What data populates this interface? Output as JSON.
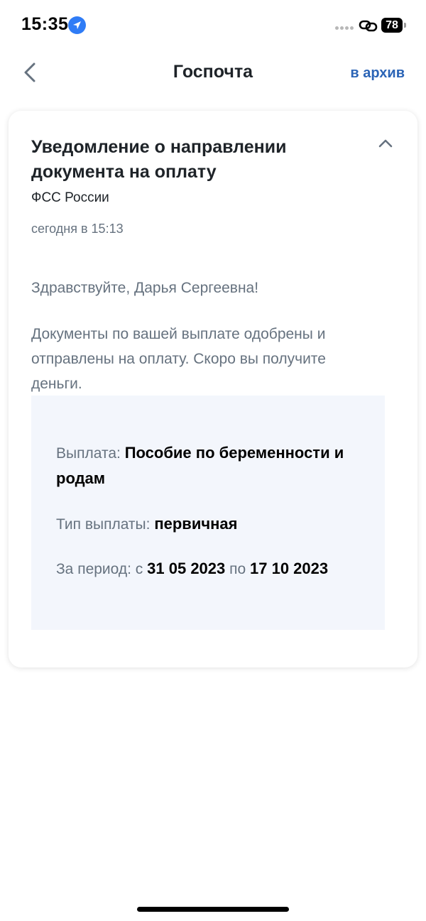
{
  "status_bar": {
    "time": "15:35",
    "battery": "78"
  },
  "header": {
    "title": "Госпочта",
    "archive_label": "в архив"
  },
  "message": {
    "title": "Уведомление о направлении документа на оплату",
    "sender": "ФСС России",
    "date": "сегодня в 15:13",
    "greeting": "Здравствуйте, Дарья Сергеевна!",
    "body": "Документы по вашей выплате одобрены и отправлены на оплату. Скоро вы получите деньги."
  },
  "details": {
    "payment_label": "Выплата:",
    "payment_value": "Пособие по беременности и родам",
    "type_label": "Тип выплаты:",
    "type_value": "первичная",
    "period_label": "За период: с",
    "period_from": "31 05 2023",
    "period_mid": "по",
    "period_to": "17 10 2023"
  },
  "colors": {
    "accent": "#2b64b6",
    "location": "#2f7cf6",
    "info_bg": "#f3f6fc",
    "muted_text": "#66727f"
  }
}
